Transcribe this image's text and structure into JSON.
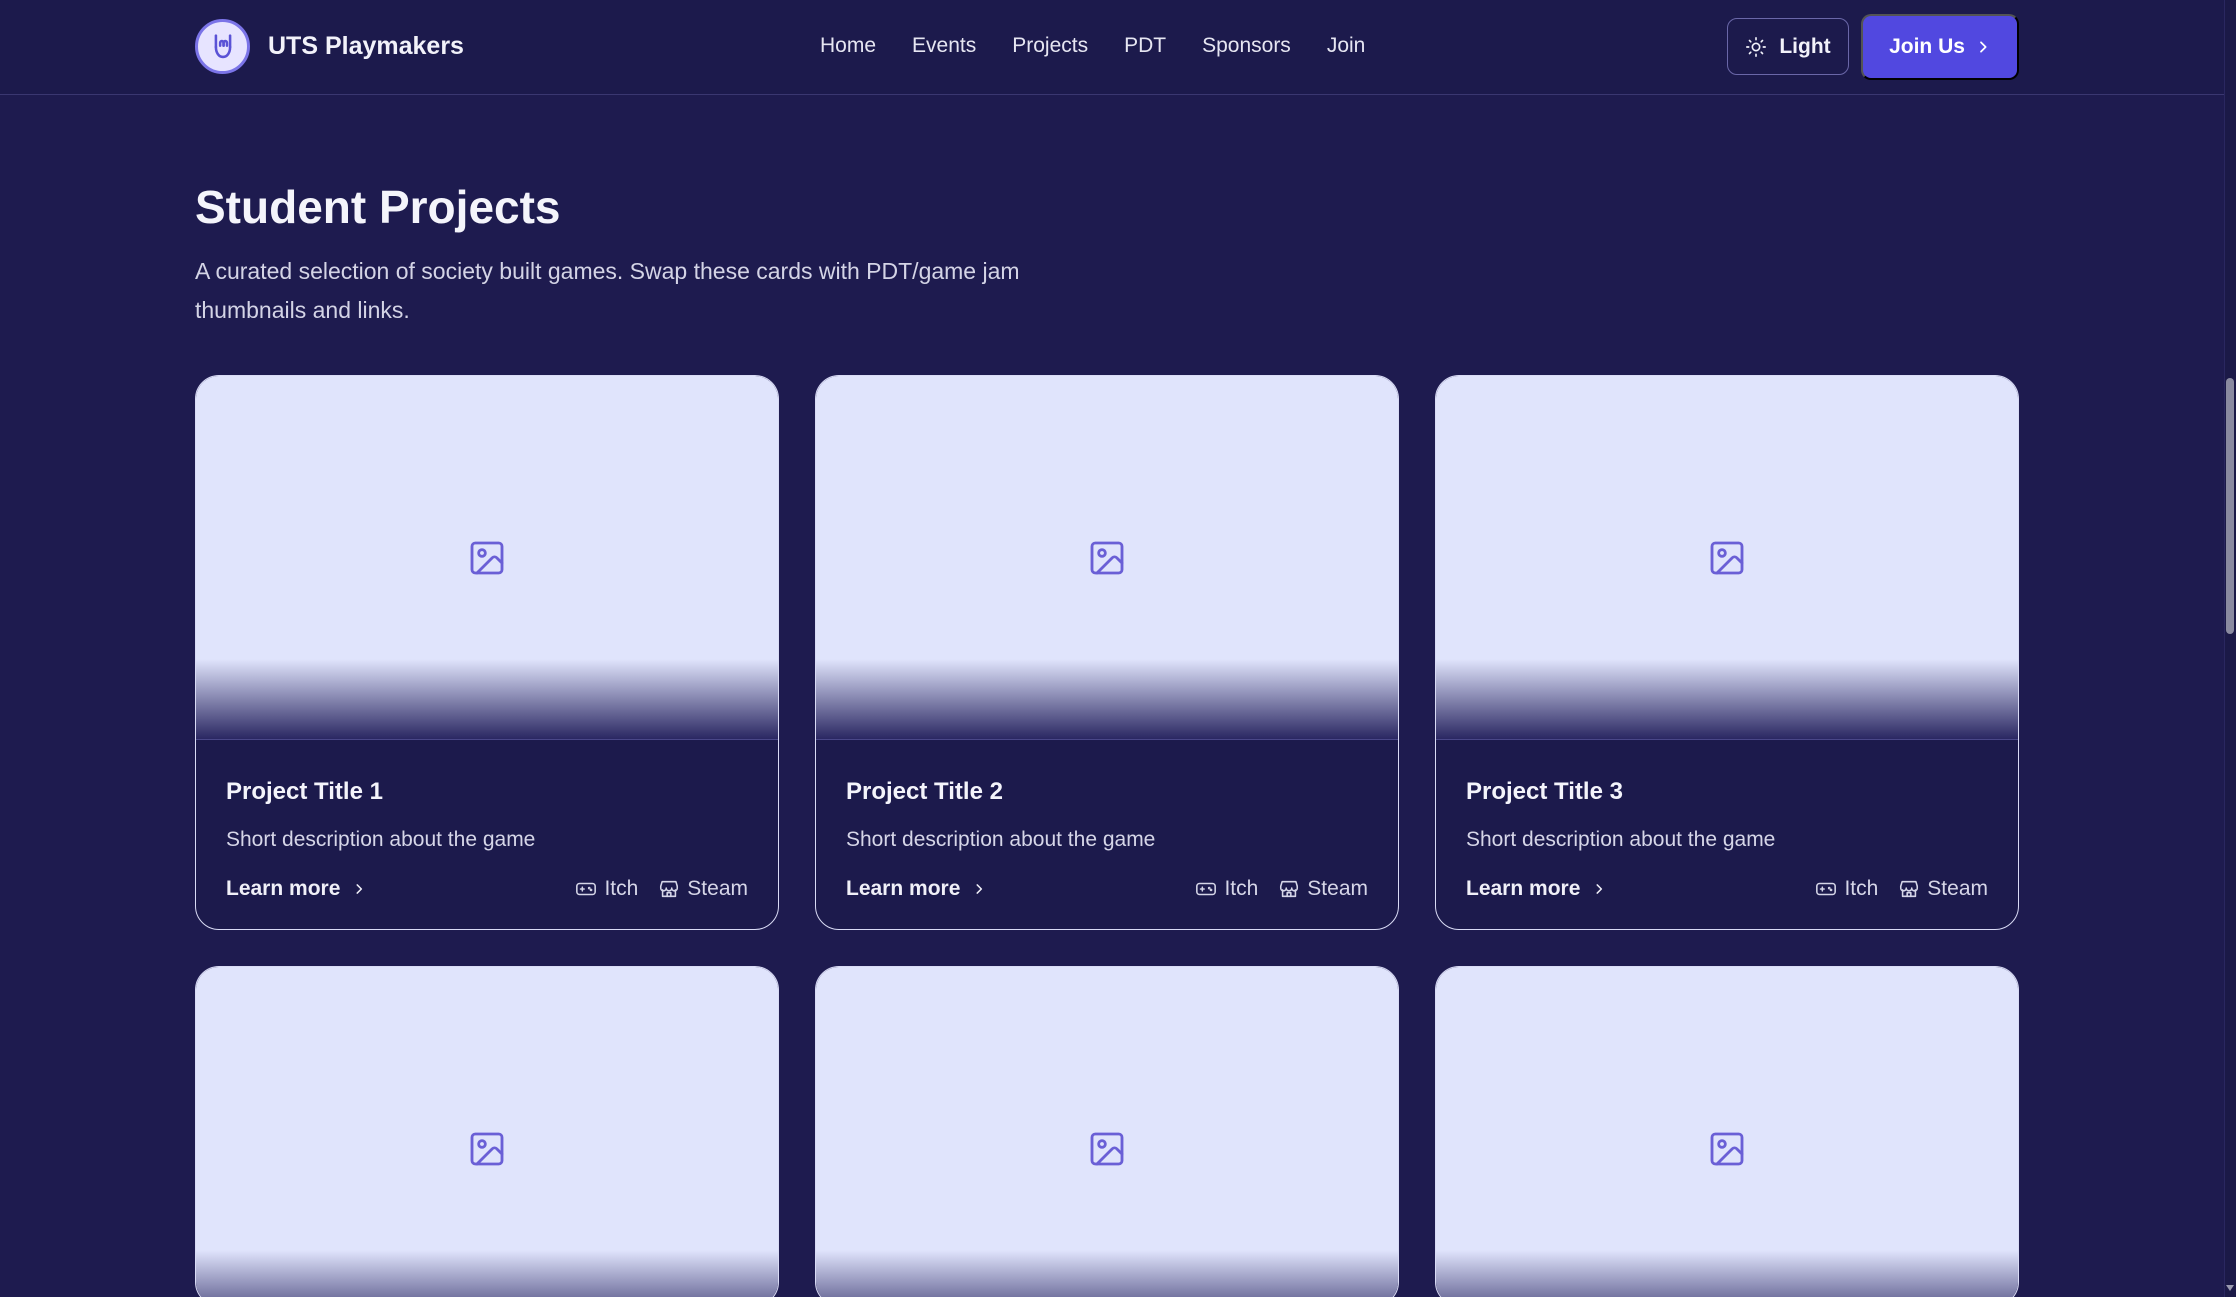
{
  "brand": {
    "name": "UTS Playmakers",
    "logo_icon": "rock-hand-icon"
  },
  "nav": {
    "links": [
      "Home",
      "Events",
      "Projects",
      "PDT",
      "Sponsors",
      "Join"
    ]
  },
  "header_actions": {
    "theme_label": "Light",
    "theme_icon": "sun-icon",
    "join_label": "Join Us",
    "join_icon": "chevron-right-icon"
  },
  "main": {
    "title": "Student Projects",
    "subtitle": "A curated selection of society built games. Swap these cards with PDT/game jam thumbnails and links."
  },
  "projects": [
    {
      "title": "Project Title 1",
      "description": "Short description about the game",
      "learn_more": "Learn more",
      "itch_label": "Itch",
      "steam_label": "Steam"
    },
    {
      "title": "Project Title 2",
      "description": "Short description about the game",
      "learn_more": "Learn more",
      "itch_label": "Itch",
      "steam_label": "Steam"
    },
    {
      "title": "Project Title 3",
      "description": "Short description about the game",
      "learn_more": "Learn more",
      "itch_label": "Itch",
      "steam_label": "Steam"
    },
    {
      "thumbnail_icon": "image-placeholder-icon"
    },
    {
      "thumbnail_icon": "image-placeholder-icon"
    },
    {
      "thumbnail_icon": "image-placeholder-icon"
    }
  ],
  "colors": {
    "background": "#1e1b4f",
    "accent": "#5148e0",
    "thumbnail": "#e0e4fc",
    "icon": "#6a5fd6"
  }
}
